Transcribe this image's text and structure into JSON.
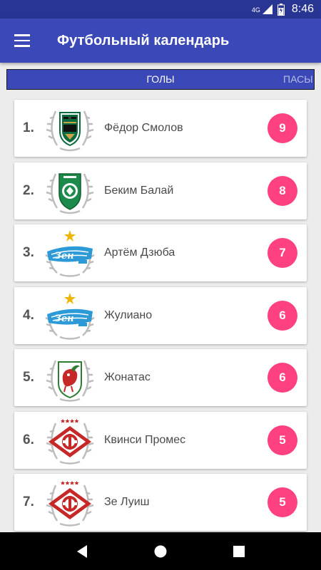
{
  "status_bar": {
    "network": "4G",
    "time": "8:46"
  },
  "app_bar": {
    "title": "Футбольный календарь",
    "menu_icon": "hamburger-menu-icon"
  },
  "tabs": [
    {
      "label": "Голы",
      "selected": true
    },
    {
      "label": "Пасы",
      "selected": false
    }
  ],
  "players": [
    {
      "rank": "1.",
      "name": "Фёдор Смолов",
      "goals": "9",
      "club_crest": "krasnodar-crest-icon"
    },
    {
      "rank": "2.",
      "name": "Беким Балай",
      "goals": "8",
      "club_crest": "akhmat-crest-icon"
    },
    {
      "rank": "3.",
      "name": "Артём Дзюба",
      "goals": "7",
      "club_crest": "zenit-crest-icon"
    },
    {
      "rank": "4.",
      "name": "Жулиано",
      "goals": "6",
      "club_crest": "zenit-crest-icon"
    },
    {
      "rank": "5.",
      "name": "Жонатас",
      "goals": "6",
      "club_crest": "rubin-crest-icon"
    },
    {
      "rank": "6.",
      "name": "Квинси Промес",
      "goals": "5",
      "club_crest": "spartak-crest-icon"
    },
    {
      "rank": "7.",
      "name": "Зе Луиш",
      "goals": "5",
      "club_crest": "spartak-crest-icon"
    }
  ],
  "colors": {
    "primary": "#3b48b8",
    "status_bar": "#283593",
    "accent": "#ff4081",
    "background": "#ececec"
  },
  "nav_bar": {
    "back_icon": "back-icon",
    "home_icon": "home-icon",
    "recents_icon": "recents-icon"
  }
}
